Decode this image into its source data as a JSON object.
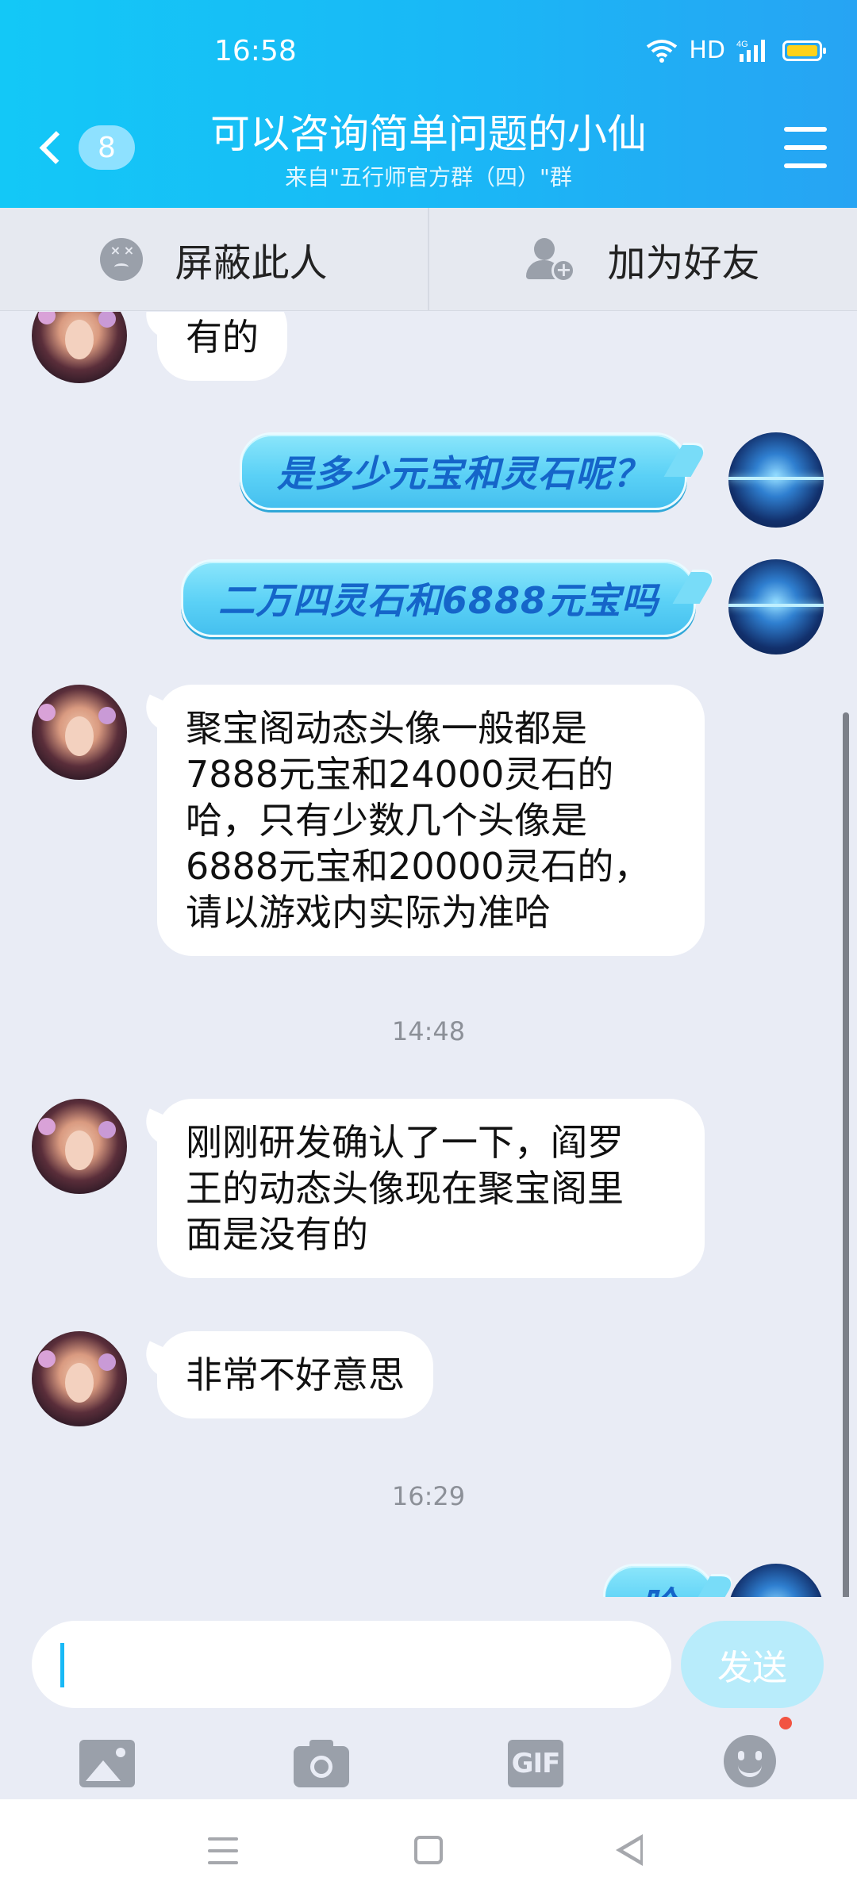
{
  "status_bar": {
    "time": "16:58",
    "network_label": "HD",
    "cell_label": "4G",
    "battery_color": "#ffd21a"
  },
  "header": {
    "back_badge": "8",
    "title": "可以咨询简单问题的小仙",
    "subtitle": "来自\"五行师官方群（四）\"群",
    "accent_color": "#19b9f6"
  },
  "actions": {
    "block_label": "屏蔽此人",
    "add_friend_label": "加为好友"
  },
  "messages": [
    {
      "side": "left",
      "text": "有的"
    },
    {
      "side": "right",
      "text": "是多少元宝和灵石呢？"
    },
    {
      "side": "right",
      "text": "二万四灵石和6888元宝吗"
    },
    {
      "side": "left",
      "lines": [
        "聚宝阁动态头像一般都是",
        "7888元宝和24000灵石的",
        "哈，只有少数几个头像是",
        "6888元宝和20000灵石的，",
        "请以游戏内实际为准哈"
      ]
    },
    {
      "type": "time",
      "text": "14:48"
    },
    {
      "side": "left",
      "lines": [
        "刚刚研发确认了一下，阎罗",
        "王的动态头像现在聚宝阁里",
        "面是没有的"
      ]
    },
    {
      "side": "left",
      "text": "非常不好意思"
    },
    {
      "type": "time",
      "text": "16:29"
    },
    {
      "side": "right",
      "text": "哈",
      "partially_visible": true
    }
  ],
  "input": {
    "value": "",
    "send_label": "发送"
  },
  "toolbar": {
    "icons": [
      "image-icon",
      "camera-icon",
      "gif-icon",
      "emoji-icon"
    ],
    "gif_label": "GIF"
  },
  "navbar": {
    "icons": [
      "recents-icon",
      "home-icon",
      "back-icon"
    ]
  }
}
